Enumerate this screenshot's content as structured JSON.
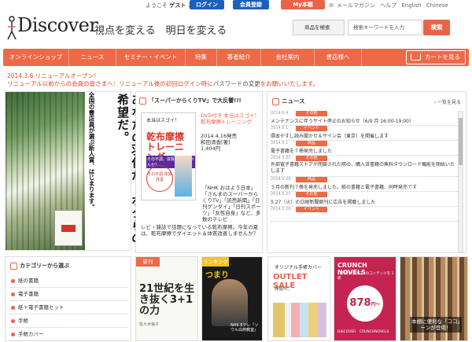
{
  "topbar": {
    "welcome_prefix": "ようこそ",
    "welcome_user": "ゲスト",
    "welcome_suffix": "さん",
    "login": "ログイン",
    "register": "会員登録",
    "mybook": "My本棚",
    "links": [
      "メールマガジン",
      "ヘルプ",
      "English",
      "Chinese"
    ]
  },
  "header": {
    "logo": "Discover",
    "tagline": "視点を変える　明日を変える"
  },
  "search": {
    "category": "商品を検索",
    "placeholder": "検索キーワードを入力",
    "button": "検索"
  },
  "nav": {
    "items": [
      "オンラインショップ",
      "ニュース",
      "セミナー・イベント",
      "特集",
      "著者紹介",
      "会社案内",
      "書店様へ"
    ],
    "cart": "カートを見る"
  },
  "announcement": {
    "line1": "2014.3.6 リニューアルオープン！",
    "line2_a": "リニューアル以前からの会員の皆さまへ：リニューアル後の初回ログイン時に",
    "line2_b": "パスワードの変更",
    "line2_c": "をお願いいたします。"
  },
  "hero": {
    "catch": "あなたの羽化が、ボクらの希望だ。",
    "sub": "全国の書店員が選ぶ新人賞、はじまります。"
  },
  "tv": {
    "heading": "「スーパーからくりTV」で大反響!!!",
    "cover_top": "本当はスゴイ！",
    "cover_title": "乾布摩擦トレーニング",
    "cover_sub": "その不調、体質改善しませんか？",
    "cover_circle": "その不調 体質改善",
    "dvd_label": "DVD付き 本当はスゴイ！乾布摩擦トレーニング",
    "release": "2014.4.16発売",
    "author": "和田清香[著]",
    "price": "1,404円",
    "quote": "「NHK おはよう日本」「さんまのスーパーからくりTV」「読売新聞」「日刊ゲンダイ」「日刊スポーツ」「女性自身」など、多数のテレビ",
    "review": "レビ・雑誌で話題になっている乾布摩擦。今年の夏は、乾布摩擦でダイエット＆体質改善しませんか？"
  },
  "news": {
    "heading": "ニュース",
    "all_link": "一覧を見る",
    "items": [
      {
        "date": "2014.6.4",
        "tag": "その他",
        "title": "メンテナンスに伴うサイト停止のお知らせ（6/9 月 16:00-19:00）"
      },
      {
        "date": "2014.6.1",
        "tag": "イベント",
        "title": "環本やすし読み聞かせ＆サイン会（東京）を開催します"
      },
      {
        "date": "2014.6.1",
        "tag": "商品",
        "title": "電子書籍を７冊発売しました"
      },
      {
        "date": "2014.5.30",
        "tag": "その他",
        "title": "外部電子書籍ストアが閉鎖された際の、購入済書籍の無料ダウンロード機能を開始いたします"
      },
      {
        "date": "2014.5.29",
        "tag": "商品",
        "title": "５月の新刊７冊を発売しました。紙の書籍と電子書籍、同時発売です"
      },
      {
        "date": "2014.5.27",
        "tag": "その他",
        "title": "5.27（火）の日経新聞朝刊に広告を掲載しました"
      },
      {
        "date": "2014.5.26",
        "tag": "イベント",
        "title": ""
      }
    ]
  },
  "category": {
    "heading": "カテゴリーから選ぶ",
    "items": [
      "紙の書籍",
      "電子書籍",
      "紙＋電子書籍セット",
      "手帳",
      "手帳カバー"
    ]
  },
  "tiles": {
    "new_badge": "新刊",
    "new_title": "21世紀を生き抜く3+1の力",
    "new_author": "佐々木裕子",
    "ranking_badge": "ランキング",
    "ranking_title": "つまり",
    "ranking_caption": "NHK Eテレ「ソウル白熱教室」",
    "outlet_top": "オリジナル手帳カバー",
    "outlet_title": "OUTLET SALE",
    "outlet_sub": "開催中。",
    "crunch_title": "CRUNCH NOVELS",
    "crunch_sub": "1冊 目からウロコのコンテンツを 1冊",
    "crunch_price": "878",
    "crunch_unit": "円〜",
    "crunch_logos": "DISCOVER　CRUNCHNOVELS",
    "shelf_caption": "本棚に便利な「ココ」ーンが登場！"
  }
}
